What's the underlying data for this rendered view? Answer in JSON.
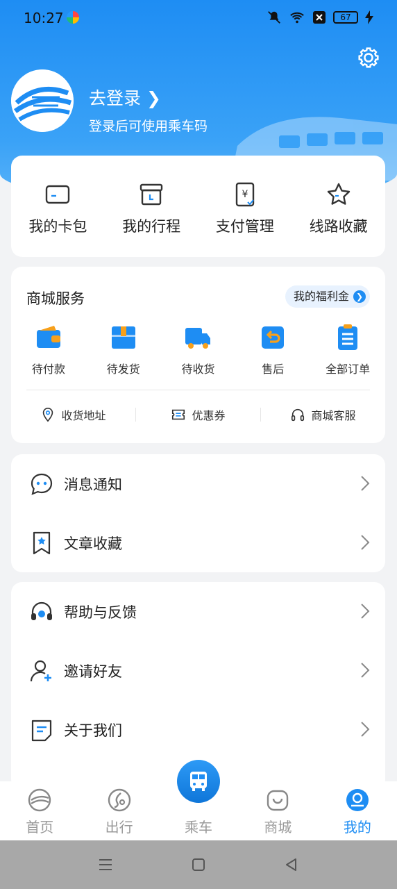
{
  "status_bar": {
    "time": "10:27",
    "battery": "67"
  },
  "header": {
    "login_title": "去登录",
    "login_subtitle": "登录后可使用乘车码"
  },
  "quick_actions": [
    {
      "label": "我的卡包",
      "icon": "card-icon"
    },
    {
      "label": "我的行程",
      "icon": "calendar-icon"
    },
    {
      "label": "支付管理",
      "icon": "payment-icon"
    },
    {
      "label": "线路收藏",
      "icon": "star-icon"
    }
  ],
  "mall": {
    "title": "商城服务",
    "welfare_label": "我的福利金",
    "orders": [
      {
        "label": "待付款",
        "icon": "wallet-icon"
      },
      {
        "label": "待发货",
        "icon": "package-icon"
      },
      {
        "label": "待收货",
        "icon": "truck-icon"
      },
      {
        "label": "售后",
        "icon": "return-icon"
      },
      {
        "label": "全部订单",
        "icon": "orders-icon"
      }
    ],
    "services": [
      {
        "label": "收货地址",
        "icon": "location-icon"
      },
      {
        "label": "优惠券",
        "icon": "coupon-icon"
      },
      {
        "label": "商城客服",
        "icon": "headset-icon"
      }
    ]
  },
  "list1": [
    {
      "label": "消息通知",
      "icon": "message-icon"
    },
    {
      "label": "文章收藏",
      "icon": "bookmark-icon"
    }
  ],
  "list2": [
    {
      "label": "帮助与反馈",
      "icon": "help-icon"
    },
    {
      "label": "邀请好友",
      "icon": "invite-icon"
    },
    {
      "label": "关于我们",
      "icon": "about-icon"
    }
  ],
  "tabbar": [
    {
      "label": "首页",
      "icon": "home-icon"
    },
    {
      "label": "出行",
      "icon": "travel-icon"
    },
    {
      "label": "乘车",
      "icon": "bus-icon"
    },
    {
      "label": "商城",
      "icon": "mall-icon"
    },
    {
      "label": "我的",
      "icon": "profile-icon"
    }
  ],
  "colors": {
    "accent": "#1e8df3",
    "hero_start": "#1e8df3",
    "hero_end": "#5ab3f8"
  }
}
